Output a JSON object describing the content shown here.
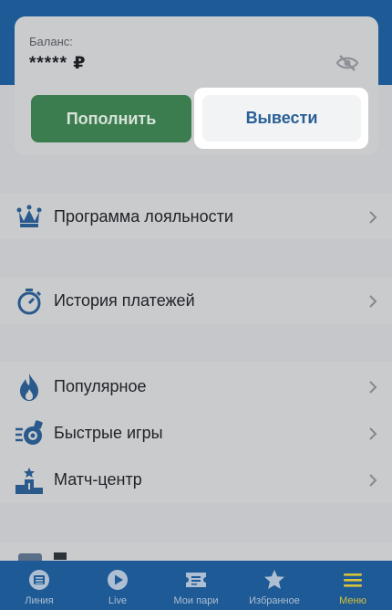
{
  "balance": {
    "label": "Баланс:",
    "value": "***** ₽",
    "deposit_label": "Пополнить",
    "withdraw_label": "Вывести"
  },
  "menu": {
    "loyalty": "Программа лояльности",
    "payment_history": "История платежей",
    "popular": "Популярное",
    "fast_games": "Быстрые игры",
    "match_center": "Матч-центр"
  },
  "tabs": [
    {
      "label": "Линия",
      "icon": "line-icon"
    },
    {
      "label": "Live",
      "icon": "play-icon"
    },
    {
      "label": "Мои пари",
      "icon": "ticket-icon"
    },
    {
      "label": "Избранное",
      "icon": "star-icon"
    },
    {
      "label": "Меню",
      "icon": "menu-icon",
      "active": true
    }
  ],
  "colors": {
    "header_blue": "#1e5a96",
    "deposit_green": "#3b7d4e",
    "withdraw_text": "#2a5f95",
    "active_tab": "#d6c23c"
  }
}
